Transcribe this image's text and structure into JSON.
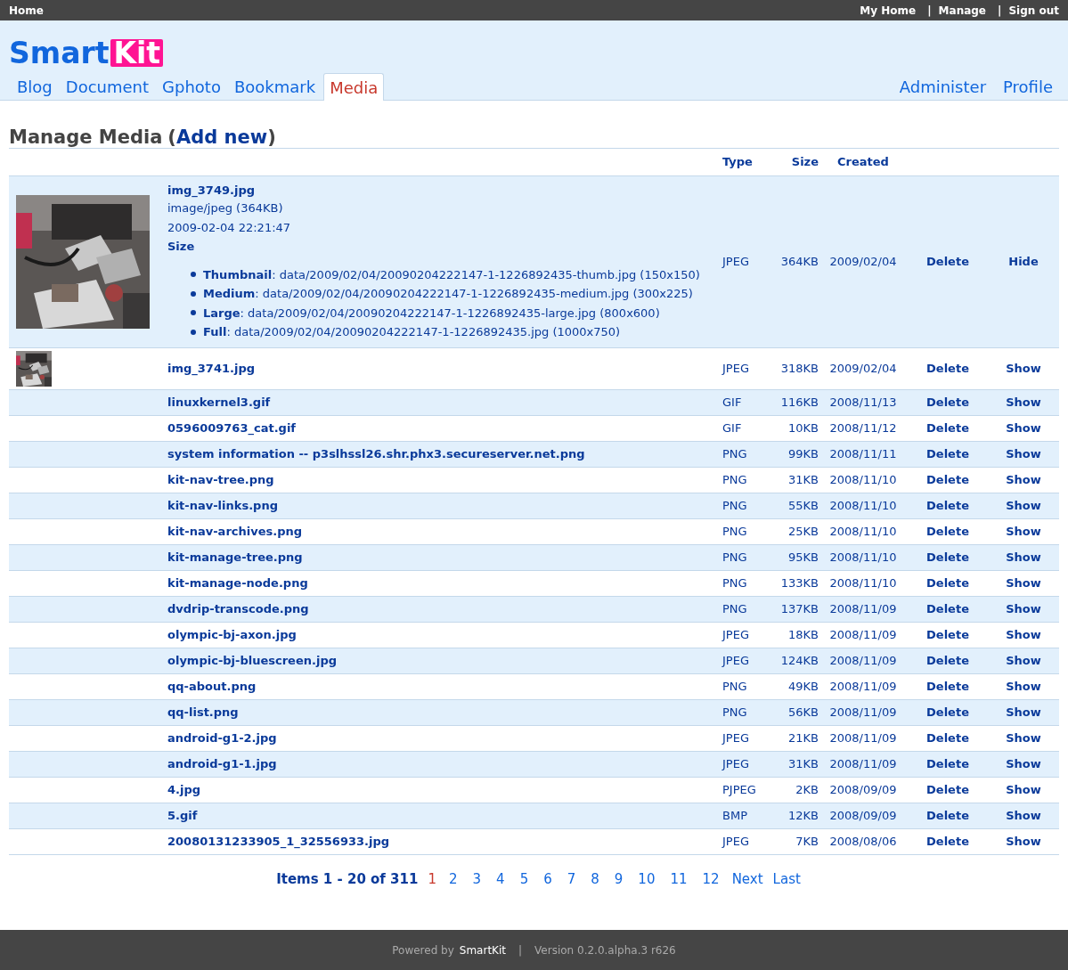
{
  "top_bar": {
    "home": "Home",
    "links": [
      "My Home",
      "Manage",
      "Sign out"
    ],
    "separator": "|"
  },
  "logo": {
    "text": "Smart",
    "badge": "Kit"
  },
  "nav": {
    "left": [
      {
        "label": "Blog",
        "selected": false
      },
      {
        "label": "Document",
        "selected": false
      },
      {
        "label": "Gphoto",
        "selected": false
      },
      {
        "label": "Bookmark",
        "selected": false
      },
      {
        "label": "Media",
        "selected": true
      }
    ],
    "right": [
      "Administer",
      "Profile"
    ]
  },
  "heading": {
    "title": "Manage Media",
    "open": "(",
    "link": "Add new",
    "close": ")"
  },
  "table": {
    "columns": [
      "Type",
      "Size",
      "Created"
    ],
    "rows": [
      {
        "name": "img_3749.jpg",
        "type": "JPEG",
        "size": "364KB",
        "created": "2009/02/04",
        "delete": "Delete",
        "toggle": "Hide",
        "details": {
          "mime": "image/jpeg (364KB)",
          "timestamp": "2009-02-04 22:21:47",
          "size_label": "Size",
          "sizes": [
            "**Thumbnail**: data/2009/02/04/20090204222147-1-1226892435-thumb.jpg (150x150)",
            "**Medium**: data/2009/02/04/20090204222147-1-1226892435-medium.jpg (300x225)",
            "**Large**: data/2009/02/04/20090204222147-1-1226892435-large.jpg (800x600)",
            "**Full**: data/2009/02/04/20090204222147-1-1226892435.jpg (1000x750)"
          ]
        }
      },
      {
        "name": "img_3741.jpg",
        "type": "JPEG",
        "size": "318KB",
        "created": "2009/02/04",
        "delete": "Delete",
        "toggle": "Show"
      },
      {
        "name": "linuxkernel3.gif",
        "type": "GIF",
        "size": "116KB",
        "created": "2008/11/13",
        "delete": "Delete",
        "toggle": "Show"
      },
      {
        "name": "0596009763_cat.gif",
        "type": "GIF",
        "size": "10KB",
        "created": "2008/11/12",
        "delete": "Delete",
        "toggle": "Show"
      },
      {
        "name": "system information -- p3slhssl26.shr.phx3.secureserver.net.png",
        "type": "PNG",
        "size": "99KB",
        "created": "2008/11/11",
        "delete": "Delete",
        "toggle": "Show"
      },
      {
        "name": "kit-nav-tree.png",
        "type": "PNG",
        "size": "31KB",
        "created": "2008/11/10",
        "delete": "Delete",
        "toggle": "Show"
      },
      {
        "name": "kit-nav-links.png",
        "type": "PNG",
        "size": "55KB",
        "created": "2008/11/10",
        "delete": "Delete",
        "toggle": "Show"
      },
      {
        "name": "kit-nav-archives.png",
        "type": "PNG",
        "size": "25KB",
        "created": "2008/11/10",
        "delete": "Delete",
        "toggle": "Show"
      },
      {
        "name": "kit-manage-tree.png",
        "type": "PNG",
        "size": "95KB",
        "created": "2008/11/10",
        "delete": "Delete",
        "toggle": "Show"
      },
      {
        "name": "kit-manage-node.png",
        "type": "PNG",
        "size": "133KB",
        "created": "2008/11/10",
        "delete": "Delete",
        "toggle": "Show"
      },
      {
        "name": "dvdrip-transcode.png",
        "type": "PNG",
        "size": "137KB",
        "created": "2008/11/09",
        "delete": "Delete",
        "toggle": "Show"
      },
      {
        "name": "olympic-bj-axon.jpg",
        "type": "JPEG",
        "size": "18KB",
        "created": "2008/11/09",
        "delete": "Delete",
        "toggle": "Show"
      },
      {
        "name": "olympic-bj-bluescreen.jpg",
        "type": "JPEG",
        "size": "124KB",
        "created": "2008/11/09",
        "delete": "Delete",
        "toggle": "Show"
      },
      {
        "name": "qq-about.png",
        "type": "PNG",
        "size": "49KB",
        "created": "2008/11/09",
        "delete": "Delete",
        "toggle": "Show"
      },
      {
        "name": "qq-list.png",
        "type": "PNG",
        "size": "56KB",
        "created": "2008/11/09",
        "delete": "Delete",
        "toggle": "Show"
      },
      {
        "name": "android-g1-2.jpg",
        "type": "JPEG",
        "size": "21KB",
        "created": "2008/11/09",
        "delete": "Delete",
        "toggle": "Show"
      },
      {
        "name": "android-g1-1.jpg",
        "type": "JPEG",
        "size": "31KB",
        "created": "2008/11/09",
        "delete": "Delete",
        "toggle": "Show"
      },
      {
        "name": "4.jpg",
        "type": "PJPEG",
        "size": "2KB",
        "created": "2008/09/09",
        "delete": "Delete",
        "toggle": "Show"
      },
      {
        "name": "5.gif",
        "type": "BMP",
        "size": "12KB",
        "created": "2008/09/09",
        "delete": "Delete",
        "toggle": "Show"
      },
      {
        "name": "20080131233905_1_32556933.jpg",
        "type": "JPEG",
        "size": "7KB",
        "created": "2008/08/06",
        "delete": "Delete",
        "toggle": "Show"
      }
    ]
  },
  "pagination": {
    "summary": "Items 1 - 20 of 311",
    "pages": [
      {
        "label": "1",
        "selected": true
      },
      {
        "label": "2",
        "selected": false
      },
      {
        "label": "3",
        "selected": false
      },
      {
        "label": "4",
        "selected": false
      },
      {
        "label": "5",
        "selected": false
      },
      {
        "label": "6",
        "selected": false
      },
      {
        "label": "7",
        "selected": false
      },
      {
        "label": "8",
        "selected": false
      },
      {
        "label": "9",
        "selected": false
      },
      {
        "label": "10",
        "selected": false
      },
      {
        "label": "11",
        "selected": false
      },
      {
        "label": "12",
        "selected": false
      }
    ],
    "next": "Next",
    "last": "Last"
  },
  "footer": {
    "powered": "Powered by",
    "brand": "SmartKit",
    "separator": "|",
    "version": "Version 0.2.0.alpha.3 r626"
  }
}
